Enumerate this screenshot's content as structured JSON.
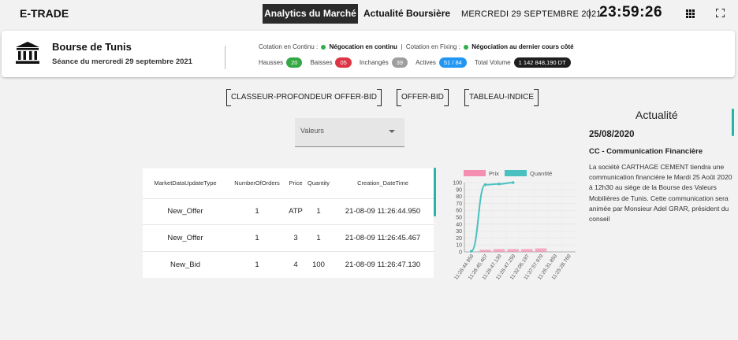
{
  "topbar": {
    "brand": "E-TRADE",
    "nav_active": "Analytics du Marché",
    "nav_link": "Actualité Boursière",
    "date": "MERCREDI 29 SEPTEMBRE 2021",
    "separator": "|",
    "clock": "23:59:26",
    "icons": [
      "grid-icon",
      "fullscreen-icon"
    ]
  },
  "header": {
    "title": "Bourse de Tunis",
    "subtitle": "Séance du mercredi 29 septembre 2021",
    "cotation_continu_label": "Cotation en Continu :",
    "cotation_continu_value": "Négocation en continu",
    "cotation_sep": "|",
    "cotation_fixing_label": "Cotation en Fixing :",
    "cotation_fixing_value": "Négociation au dernier cours côté",
    "status_color": "#2fae4a",
    "stats": {
      "hausses_label": "Hausses",
      "hausses": "20",
      "baisses_label": "Baisses",
      "baisses": "05",
      "inchanges_label": "Inchangés",
      "inchanges": "39",
      "actives_label": "Actives",
      "actives": "51 / 84",
      "volume_label": "Total Volume",
      "volume": "1 142 848,190 DT"
    }
  },
  "tabs": [
    "CLASSEUR-PROFONDEUR OFFER-BID",
    "OFFER-BID",
    "TABLEAU-INDICE"
  ],
  "select": {
    "label": "Valeurs"
  },
  "table": {
    "headers": [
      "MarketDataUpdateType",
      "NumberOfOrders",
      "Price",
      "Quantity",
      "Creation_DateTime"
    ],
    "rows": [
      [
        "New_Offer",
        "1",
        "ATP",
        "1",
        "21-08-09 11:26:44.950"
      ],
      [
        "New_Offer",
        "1",
        "3",
        "1",
        "21-08-09 11:26:45.467"
      ],
      [
        "New_Bid",
        "1",
        "4",
        "100",
        "21-08-09 11:26:47.130"
      ]
    ]
  },
  "chart_data": {
    "type": "bar",
    "categories": [
      "11:26:44.950",
      "11:26:45.467",
      "11:26:47.130",
      "11:26:47.250",
      "11:32:06.197",
      "11:37:57.970",
      "11:26:31.850",
      "11:25:28.760"
    ],
    "series": [
      {
        "name": "Prix",
        "kind": "bar",
        "color": "#f48fb1",
        "values": [
          0,
          3,
          4,
          4,
          4,
          5,
          0,
          0
        ]
      },
      {
        "name": "Quantité",
        "kind": "line",
        "color": "#4bc0c0",
        "values": [
          1,
          97,
          98,
          100,
          null,
          null,
          null,
          null
        ]
      }
    ],
    "ylim": [
      0,
      100
    ],
    "yticks": [
      0,
      10,
      20,
      30,
      40,
      50,
      60,
      70,
      80,
      90,
      100
    ]
  },
  "actualite": {
    "title": "Actualité",
    "date": "25/08/2020",
    "heading": "CC - Communication Financière",
    "body": "La société CARTHAGE CEMENT tiendra une communication financière le Mardi 25 Août 2020 à 12h30 au siège de la Bourse des Valeurs Mobilières de Tunis. Cette communication sera animée par Monsieur Adel GRAR, président du conseil"
  }
}
